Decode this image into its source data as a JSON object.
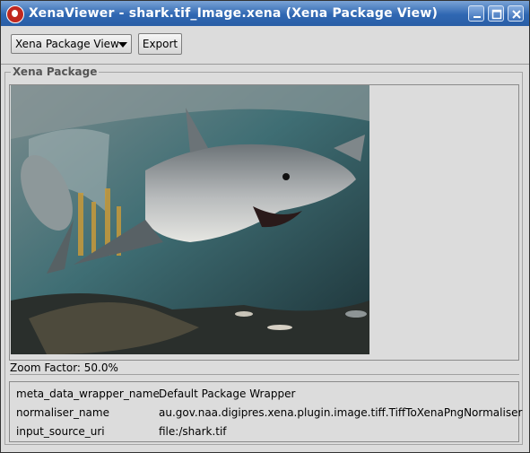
{
  "window": {
    "title": "XenaViewer - shark.tif_Image.xena (Xena Package View)",
    "controls": [
      "minimize-icon",
      "maximize-icon",
      "close-icon"
    ]
  },
  "toolbar": {
    "view_select": "Xena Package View",
    "export_label": "Export"
  },
  "package": {
    "group_label": "Xena Package",
    "zoom_text": "Zoom Factor: 50.0%",
    "metadata": [
      {
        "key": "meta_data_wrapper_name",
        "value": "Default Package Wrapper"
      },
      {
        "key": "normaliser_name",
        "value": "au.gov.naa.digipres.xena.plugin.image.tiff.TiffToXenaPngNormaliser"
      },
      {
        "key": "input_source_uri",
        "value": "file:/shark.tif"
      }
    ]
  },
  "colors": {
    "titlebar": "#2f67b2",
    "background": "#dcdcdc"
  }
}
